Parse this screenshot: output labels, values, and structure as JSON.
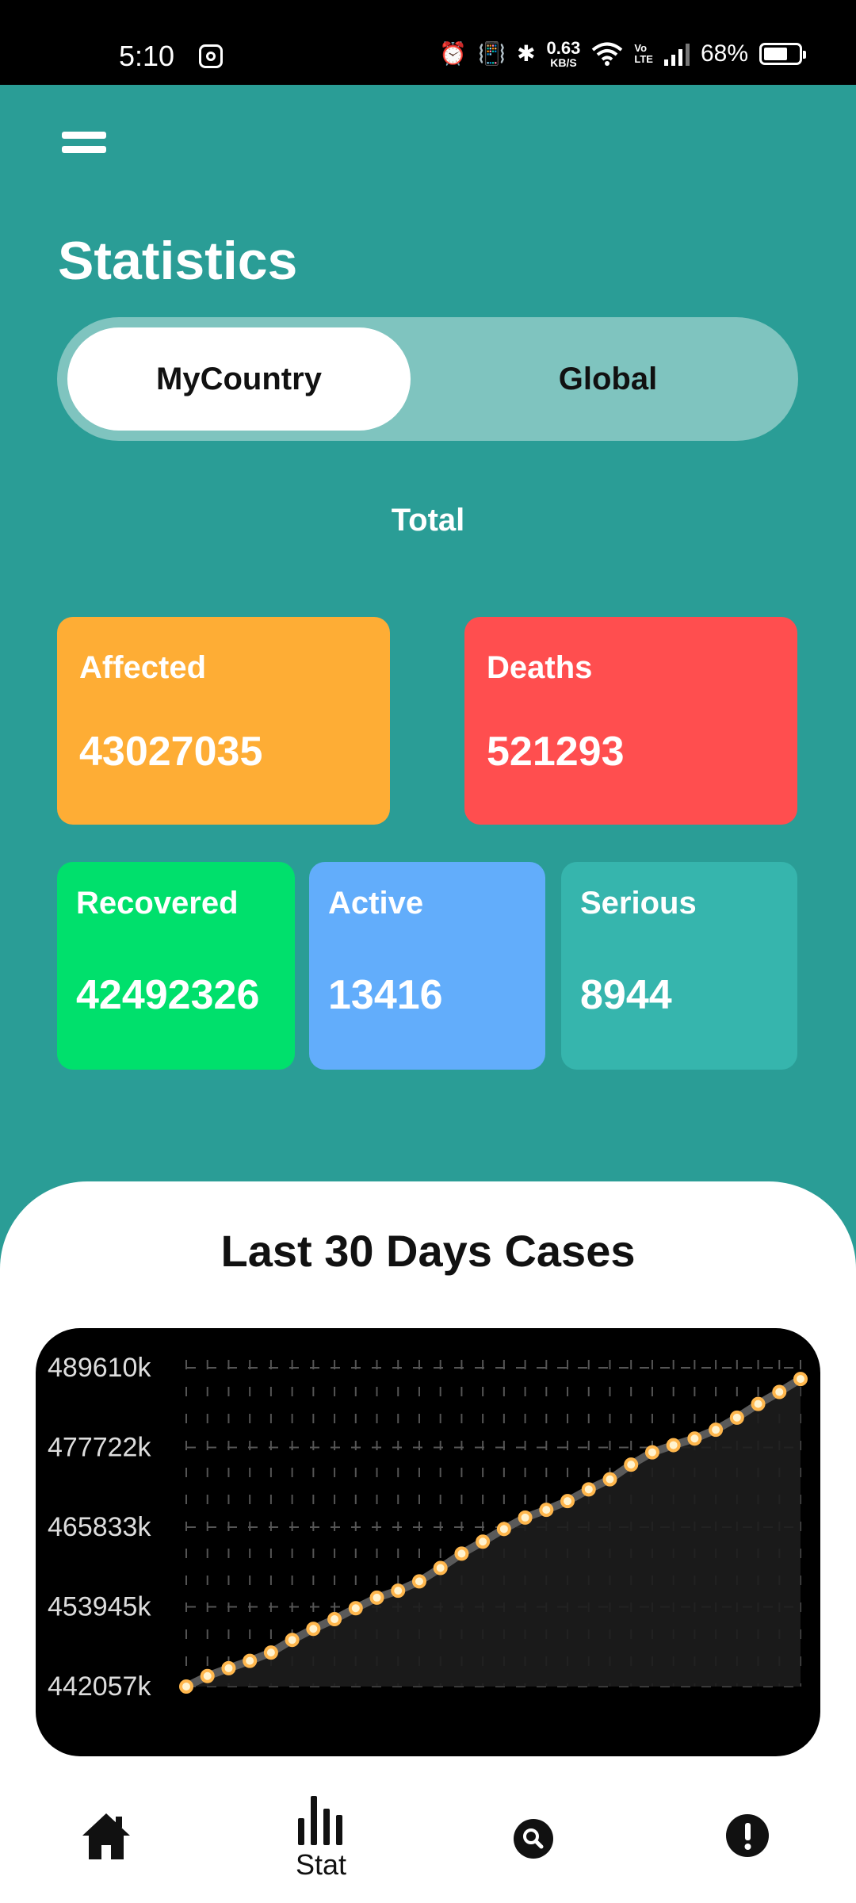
{
  "status_bar": {
    "time": "5:10",
    "speed_value": "0.63",
    "speed_unit": "KB/S",
    "volte_top": "Vo",
    "volte_bottom": "LTE",
    "battery": "68%",
    "battery_level": 0.68,
    "icons": [
      "instagram-icon",
      "alarm-icon",
      "vibrate-icon",
      "bluetooth-icon",
      "wifi-icon",
      "signal-icon",
      "battery-icon"
    ]
  },
  "header": {
    "menu_icon": "hamburger-menu-icon",
    "title": "Statistics"
  },
  "toggle": {
    "options": [
      "MyCountry",
      "Global"
    ],
    "selected": "MyCountry"
  },
  "section_label": "Total",
  "stats": {
    "affected": {
      "label": "Affected",
      "value": "43027035",
      "color": "#fead35"
    },
    "deaths": {
      "label": "Deaths",
      "value": "521293",
      "color": "#ff4e4f"
    },
    "recovered": {
      "label": "Recovered",
      "value": "42492326",
      "color": "#00e06c"
    },
    "active": {
      "label": "Active",
      "value": "13416",
      "color": "#62adfb"
    },
    "serious": {
      "label": "Serious",
      "value": "8944",
      "color": "#36b5ad"
    }
  },
  "chart_section": {
    "title": "Last 30 Days Cases"
  },
  "chart_data": {
    "type": "line",
    "title": "Last 30 Days Cases",
    "ytick_labels": [
      "489610k",
      "477722k",
      "465833k",
      "453945k",
      "442057k"
    ],
    "ylim": [
      442057,
      489610
    ],
    "grid": true,
    "line_color": "#ffb74d",
    "x": [
      1,
      2,
      3,
      4,
      5,
      6,
      7,
      8,
      9,
      10,
      11,
      12,
      13,
      14,
      15,
      16,
      17,
      18,
      19,
      20,
      21,
      22,
      23,
      24,
      25,
      26,
      27,
      28,
      29,
      30
    ],
    "values": [
      442057,
      443622,
      444788,
      445884,
      447131,
      449013,
      450660,
      452107,
      453739,
      455316,
      456356,
      457744,
      459741,
      461888,
      463673,
      465559,
      467262,
      468421,
      469719,
      471473,
      472974,
      475162,
      477002,
      478068,
      479050,
      480365,
      482176,
      484215,
      485998,
      487943
    ]
  },
  "bottom_nav": {
    "items": [
      {
        "icon": "home-icon",
        "label": ""
      },
      {
        "icon": "bar-chart-icon",
        "label": "Stat"
      },
      {
        "icon": "search-icon",
        "label": ""
      },
      {
        "icon": "info-icon",
        "label": ""
      }
    ]
  }
}
